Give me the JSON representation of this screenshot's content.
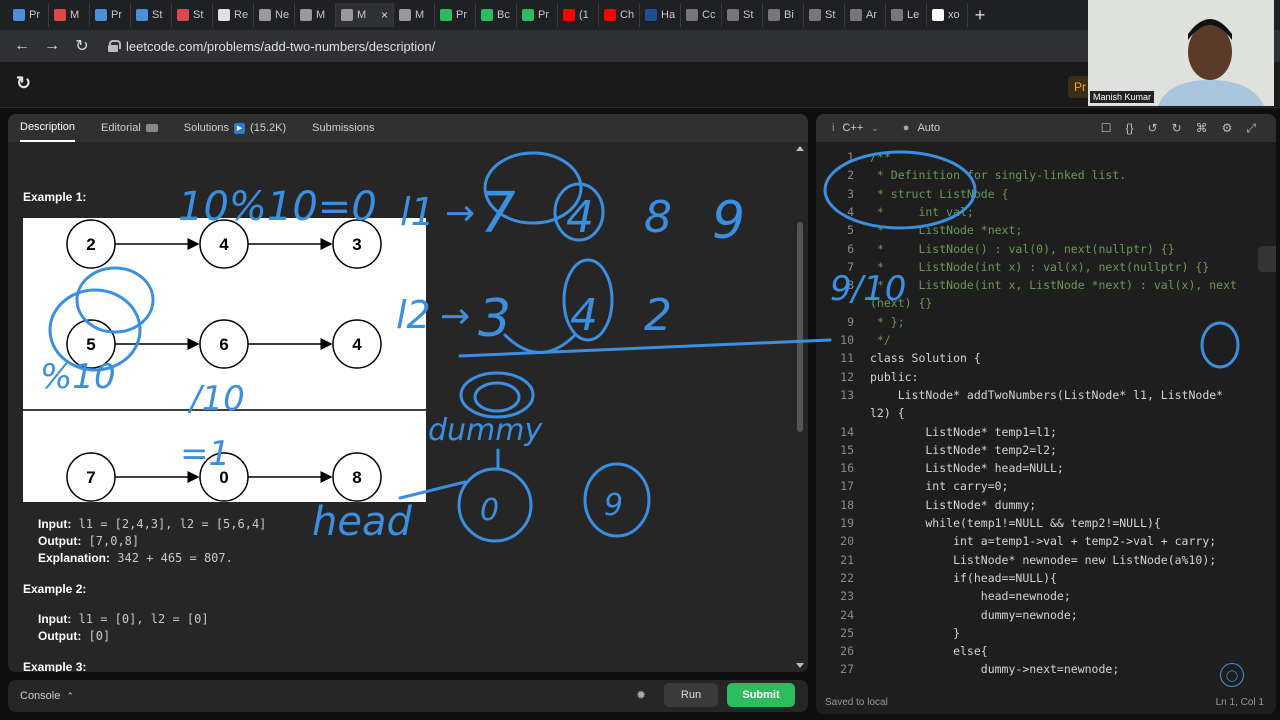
{
  "browser": {
    "tabs": [
      {
        "label": "Pr",
        "color": "#4a90d9",
        "active": false
      },
      {
        "label": "M",
        "color": "#d94a4a",
        "active": false
      },
      {
        "label": "Pr",
        "color": "#4a90d9",
        "active": false
      },
      {
        "label": "St",
        "color": "#4a90d9",
        "active": false
      },
      {
        "label": "St",
        "color": "#d94a4a",
        "active": false
      },
      {
        "label": "Re",
        "color": "#e0e0e0",
        "active": false
      },
      {
        "label": "Ne",
        "color": "#999999",
        "active": false
      },
      {
        "label": "M",
        "color": "#999999",
        "active": false
      },
      {
        "label": "M",
        "color": "#999999",
        "active": true
      },
      {
        "label": "M",
        "color": "#999999",
        "active": false
      },
      {
        "label": "Pr",
        "color": "#2cbb5d",
        "active": false
      },
      {
        "label": "Bc",
        "color": "#2cbb5d",
        "active": false
      },
      {
        "label": "Pr",
        "color": "#2cbb5d",
        "active": false
      },
      {
        "label": "(1",
        "color": "#ff0000",
        "active": false
      },
      {
        "label": "Ch",
        "color": "#ff0000",
        "active": false
      },
      {
        "label": "Ha",
        "color": "#1f4e8f",
        "active": false
      },
      {
        "label": "Cc",
        "color": "#777777",
        "active": false
      },
      {
        "label": "St",
        "color": "#777777",
        "active": false
      },
      {
        "label": "Bi",
        "color": "#777777",
        "active": false
      },
      {
        "label": "St",
        "color": "#777777",
        "active": false
      },
      {
        "label": "Ar",
        "color": "#777777",
        "active": false
      },
      {
        "label": "Le",
        "color": "#777777",
        "active": false
      },
      {
        "label": "xo",
        "color": "#ffffff",
        "active": false
      }
    ],
    "new_tab": "+",
    "url": "leetcode.com/problems/add-two-numbers/description/"
  },
  "problem_tabs": {
    "description": "Description",
    "editorial": "Editorial",
    "solutions": "Solutions",
    "solutions_count": "(15.2K)",
    "submissions": "Submissions"
  },
  "description": {
    "example1_title": "Example 1:",
    "example1_input_label": "Input:",
    "example1_input": "l1 = [2,4,3], l2 = [5,6,4]",
    "example1_output_label": "Output:",
    "example1_output": "[7,0,8]",
    "example1_expl_label": "Explanation:",
    "example1_expl": "342 + 465 = 807.",
    "example2_title": "Example 2:",
    "example2_input_label": "Input:",
    "example2_input": "l1 = [0], l2 = [0]",
    "example2_output_label": "Output:",
    "example2_output": "[0]",
    "example3_title": "Example 3:",
    "diagram_row1": [
      "2",
      "4",
      "3"
    ],
    "diagram_row2": [
      "5",
      "6",
      "4"
    ],
    "diagram_row3": [
      "7",
      "0",
      "8"
    ]
  },
  "console": {
    "label": "Console",
    "run": "Run",
    "submit": "Submit"
  },
  "editor": {
    "language": "C++",
    "mode": "Auto",
    "status": "Saved to local",
    "cursor": "Ln 1, Col 1",
    "lines": [
      {
        "n": "1",
        "t": "/**"
      },
      {
        "n": "2",
        "t": " * Definition for singly-linked list."
      },
      {
        "n": "3",
        "t": " * struct ListNode {"
      },
      {
        "n": "4",
        "t": " *     int val;"
      },
      {
        "n": "5",
        "t": " *     ListNode *next;"
      },
      {
        "n": "6",
        "t": " *     ListNode() : val(0), next(nullptr) {}"
      },
      {
        "n": "7",
        "t": " *     ListNode(int x) : val(x), next(nullptr) {}"
      },
      {
        "n": "8",
        "t": " *     ListNode(int x, ListNode *next) : val(x), next"
      },
      {
        "n": "",
        "t": "(next) {}"
      },
      {
        "n": "9",
        "t": " * };"
      },
      {
        "n": "10",
        "t": " */"
      },
      {
        "n": "11",
        "t": "class Solution {"
      },
      {
        "n": "12",
        "t": "public:"
      },
      {
        "n": "13",
        "t": "    ListNode* addTwoNumbers(ListNode* l1, ListNode*"
      },
      {
        "n": "",
        "t": "l2) {"
      },
      {
        "n": "14",
        "t": "        ListNode* temp1=l1;"
      },
      {
        "n": "15",
        "t": "        ListNode* temp2=l2;"
      },
      {
        "n": "16",
        "t": "        ListNode* head=NULL;"
      },
      {
        "n": "17",
        "t": "        int carry=0;"
      },
      {
        "n": "18",
        "t": "        ListNode* dummy;"
      },
      {
        "n": "19",
        "t": "        while(temp1!=NULL && temp2!=NULL){"
      },
      {
        "n": "20",
        "t": "            int a=temp1->val + temp2->val + carry;"
      },
      {
        "n": "21",
        "t": "            ListNode* newnode= new ListNode(a%10);"
      },
      {
        "n": "22",
        "t": "            if(head==NULL){"
      },
      {
        "n": "23",
        "t": "                head=newnode;"
      },
      {
        "n": "24",
        "t": "                dummy=newnode;"
      },
      {
        "n": "25",
        "t": "            }"
      },
      {
        "n": "26",
        "t": "            else{"
      },
      {
        "n": "27",
        "t": "                dummy->next=newnode;"
      }
    ]
  },
  "webcam": {
    "name": "Manish Kumar",
    "premium": "Pr"
  },
  "annotations": {
    "top_calc": "10%10=0",
    "l1": "l1",
    "l1_digits": [
      "7",
      "4",
      "8",
      "9"
    ],
    "l2": "l2",
    "l2_digits": [
      "3",
      "4",
      "2"
    ],
    "dummy": "dummy",
    "head": "head",
    "head_node": "0",
    "next_node": "9",
    "left_calc": "%10",
    "left_calc2": "/10",
    "mid_calc": "=1",
    "carry_calc": "9/10"
  },
  "colors": {
    "ink": "#3b8fe0",
    "submit": "#2cbb5d",
    "accent": "#ffa116"
  }
}
